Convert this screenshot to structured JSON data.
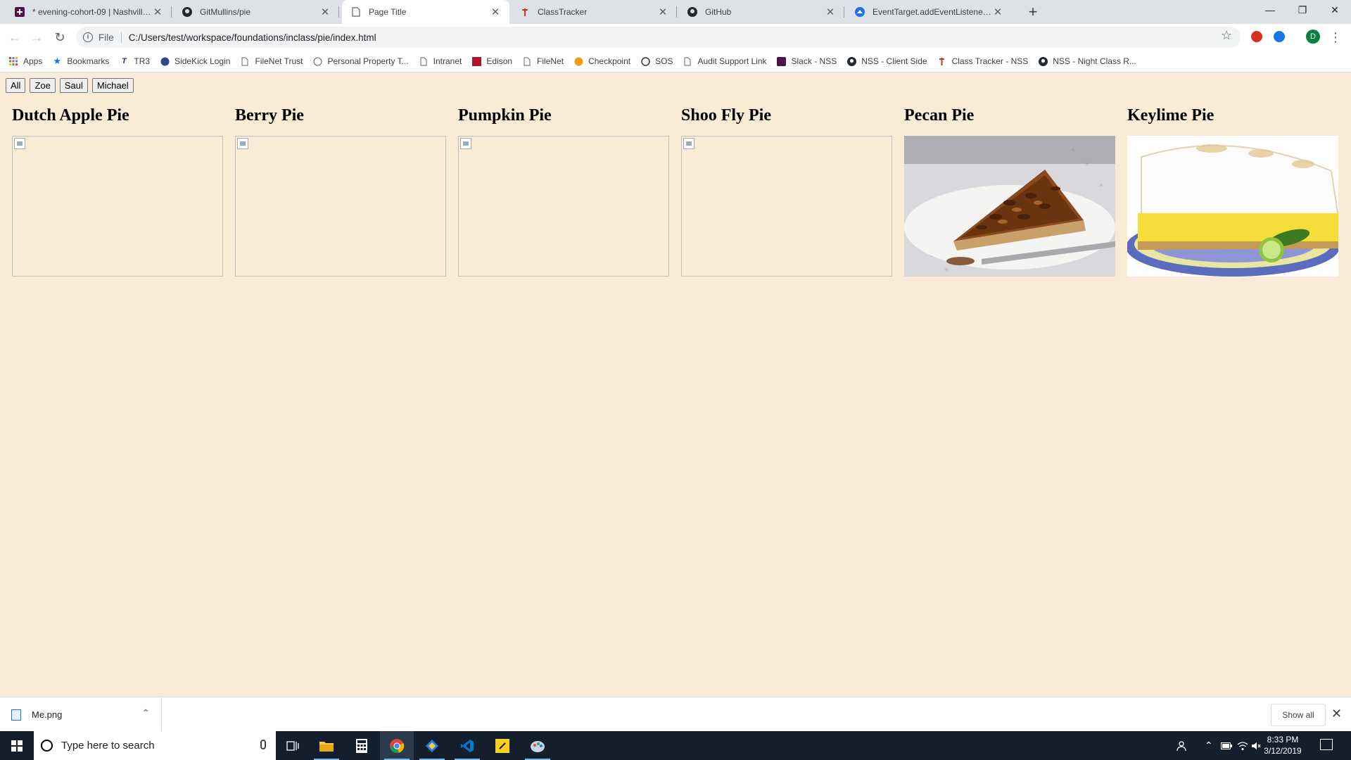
{
  "browser": {
    "tabs": [
      {
        "title": "* evening-cohort-09 | Nashville S",
        "icon": "slack-icon",
        "active": false
      },
      {
        "title": "GitMullins/pie",
        "icon": "github-icon",
        "active": false
      },
      {
        "title": "Page Title",
        "icon": "page-icon",
        "active": true
      },
      {
        "title": "ClassTracker",
        "icon": "classtracker-icon",
        "active": false
      },
      {
        "title": "GitHub",
        "icon": "github-icon",
        "active": false
      },
      {
        "title": "EventTarget.addEventListener() -",
        "icon": "mdn-icon",
        "active": false
      }
    ],
    "address": {
      "scheme": "File",
      "url": "C:/Users/test/workspace/foundations/inclass/pie/index.html"
    },
    "profile_initial": "D",
    "bookmarks": [
      {
        "label": "Apps",
        "icon": "apps-grid-icon"
      },
      {
        "label": "Bookmarks",
        "icon": "star-icon"
      },
      {
        "label": "TR3",
        "icon": "tr3-icon"
      },
      {
        "label": "SideKick Login",
        "icon": "sidekick-icon"
      },
      {
        "label": "FileNet Trust",
        "icon": "page-icon"
      },
      {
        "label": "Personal Property T...",
        "icon": "globe-icon"
      },
      {
        "label": "Intranet",
        "icon": "page-icon"
      },
      {
        "label": "Edison",
        "icon": "edison-icon"
      },
      {
        "label": "FileNet",
        "icon": "page-icon"
      },
      {
        "label": "Checkpoint",
        "icon": "checkpoint-icon"
      },
      {
        "label": "SOS",
        "icon": "sos-icon"
      },
      {
        "label": "Audit Support Link",
        "icon": "page-icon"
      },
      {
        "label": "Slack - NSS",
        "icon": "slack-icon"
      },
      {
        "label": "NSS - Client Side",
        "icon": "github-icon"
      },
      {
        "label": "Class Tracker - NSS",
        "icon": "classtracker-icon"
      },
      {
        "label": "NSS - Night Class R...",
        "icon": "github-icon"
      }
    ]
  },
  "page": {
    "background": "#faebd7",
    "filter_buttons": [
      "All",
      "Zoe",
      "Saul",
      "Michael"
    ],
    "pies": [
      {
        "name": "Dutch Apple Pie",
        "image": "broken"
      },
      {
        "name": "Berry Pie",
        "image": "broken"
      },
      {
        "name": "Pumpkin Pie",
        "image": "broken"
      },
      {
        "name": "Shoo Fly Pie",
        "image": "broken"
      },
      {
        "name": "Pecan Pie",
        "image": "pecan-pie-photo"
      },
      {
        "name": "Keylime Pie",
        "image": "keylime-pie-photo"
      }
    ]
  },
  "downloads": {
    "file": "Me.png",
    "show_all": "Show all"
  },
  "taskbar": {
    "search_placeholder": "Type here to search",
    "time": "8:33 PM",
    "date": "3/12/2019"
  }
}
